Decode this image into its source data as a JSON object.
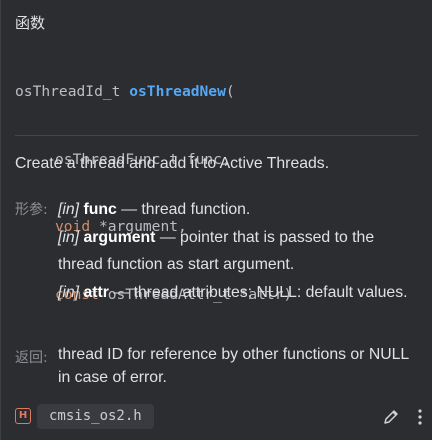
{
  "section_title": "函数",
  "signature": {
    "return_type": "osThreadId_t",
    "function_name": "osThreadNew",
    "open_paren": "(",
    "params": [
      {
        "type": "osThreadFunc_t",
        "name": "func",
        "sep": ","
      },
      {
        "type_kw": "void",
        "name": "*argument",
        "sep": ","
      },
      {
        "type_kw": "const",
        "type": "osThreadAttr_t",
        "name": "*attr",
        "sep": ")"
      }
    ]
  },
  "description": "Create a thread and add it to Active Threads.",
  "params_label": "形参:",
  "params": [
    {
      "tag": "[in]",
      "name": "func",
      "text": " — thread function."
    },
    {
      "tag": "[in]",
      "name": "argument",
      "text": " — pointer that is passed to the thread function as start argument."
    },
    {
      "tag": "[in]",
      "name": "attr",
      "text": " — thread attributes; NULL: default values."
    }
  ],
  "returns_label": "返回:",
  "returns_text": "thread ID for reference by other functions or NULL in case of error.",
  "footer": {
    "file_icon_letter": "H",
    "file_name": "cmsis_os2.h"
  },
  "colors": {
    "background": "#2b2d30",
    "keyword": "#cf8e6d",
    "function": "#56a8f5",
    "header_icon": "#e07a5f"
  },
  "icons": [
    "header-file-icon",
    "pencil-icon",
    "more-vertical-icon"
  ]
}
